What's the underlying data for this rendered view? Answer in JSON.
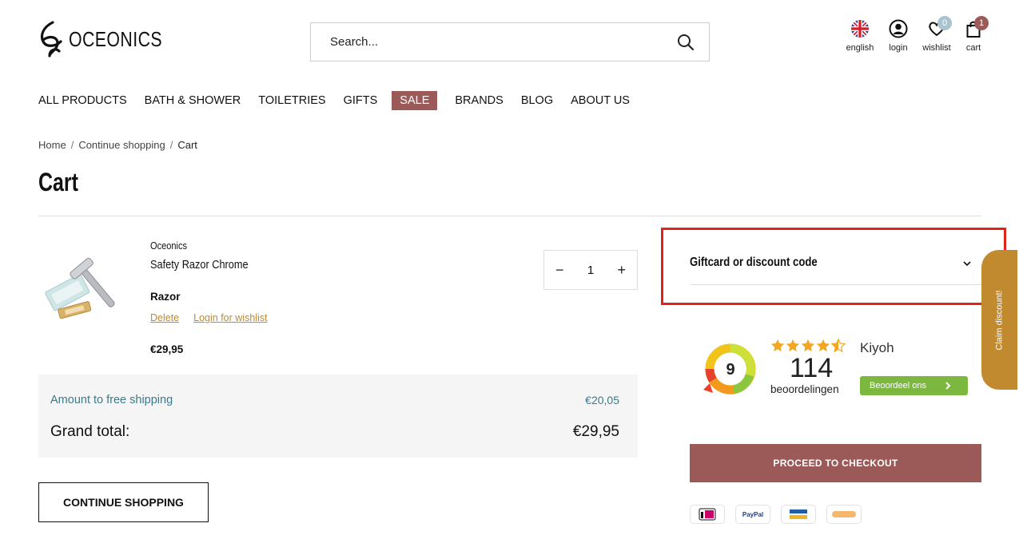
{
  "header": {
    "brand": "OCEONICS",
    "search_placeholder": "Search...",
    "icons": {
      "language": "english",
      "login": "login",
      "wishlist": "wishlist",
      "wishlist_count": "0",
      "cart": "cart",
      "cart_count": "1"
    }
  },
  "nav": [
    "ALL PRODUCTS",
    "BATH & SHOWER",
    "TOILETRIES",
    "GIFTS",
    "SALE",
    "BRANDS",
    "BLOG",
    "ABOUT US"
  ],
  "breadcrumb": {
    "home": "Home",
    "continue": "Continue shopping",
    "current": "Cart",
    "sep": "/"
  },
  "page_title": "Cart",
  "cart_item": {
    "brand": "Oceonics",
    "name": "Safety Razor Chrome",
    "variant": "Razor",
    "delete": "Delete",
    "wishlist": "Login for wishlist",
    "price": "€29,95",
    "qty": "1",
    "minus": "−",
    "plus": "+"
  },
  "totals": {
    "shipping_label": "Amount to free shipping",
    "shipping_value": "€20,05",
    "grand_label": "Grand total:",
    "grand_value": "€29,95"
  },
  "continue_btn": "CONTINUE SHOPPING",
  "giftcard": "Giftcard or discount code",
  "kiyoh": {
    "score": "9",
    "name": "Kiyoh",
    "count": "114",
    "reviews_label": "beoordelingen",
    "rating_stars": 4.5,
    "button": "Beoordeel ons"
  },
  "checkout_btn": "PROCEED TO CHECKOUT",
  "payments": [
    "iDEAL",
    "PayPal",
    "Bancontact",
    "in3"
  ],
  "claim": "Claim discount!",
  "colors": {
    "brand": "#9b5a57",
    "link": "#c08a2d",
    "shipping": "#3c7a8a",
    "kiyoh_green": "#7cb83f",
    "highlight": "#e2231a"
  }
}
